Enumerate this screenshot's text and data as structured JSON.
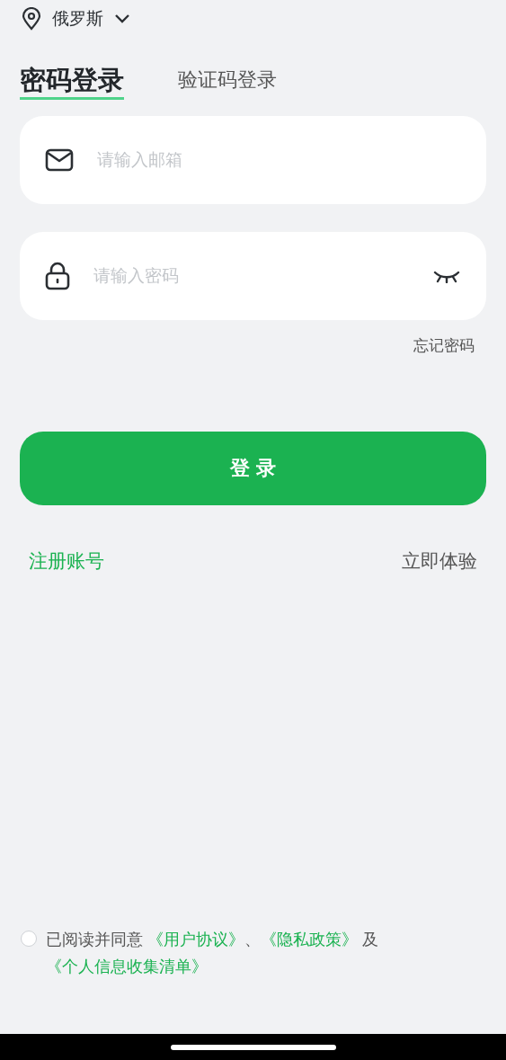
{
  "location": {
    "label": "俄罗斯"
  },
  "tabs": [
    {
      "label": "密码登录",
      "selected": true
    },
    {
      "label": "验证码登录",
      "selected": false
    }
  ],
  "fields": [
    {
      "kind": "email",
      "placeholder": "请输入邮箱"
    },
    {
      "kind": "password",
      "placeholder": "请输入密码",
      "password_visible": false
    }
  ],
  "forgot_password": "忘记密码",
  "login_button": "登 录",
  "register_link": "注册账号",
  "try_now_link": "立即体验",
  "agreement": {
    "checked": false,
    "parts": [
      {
        "kind": "text",
        "text": "已阅读并同意 "
      },
      {
        "kind": "link",
        "text": "《用户协议》"
      },
      {
        "kind": "text",
        "text": "、"
      },
      {
        "kind": "link",
        "text": "《隐私政策》"
      },
      {
        "kind": "text",
        "text": " 及 "
      },
      {
        "kind": "link",
        "text": "《个人信息收集清单》"
      }
    ]
  }
}
